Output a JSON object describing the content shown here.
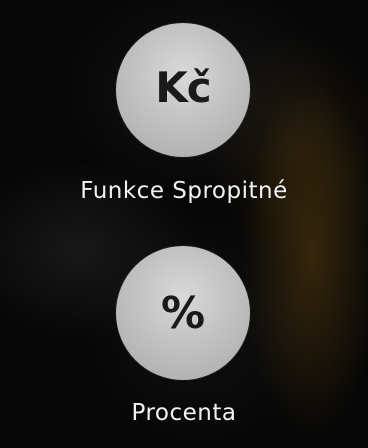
{
  "options": [
    {
      "icon": "koruna-currency-icon",
      "glyph": "Kč",
      "label": "Funkce Spropitné"
    },
    {
      "icon": "percent-icon",
      "glyph": "%",
      "label": "Procenta"
    }
  ],
  "colors": {
    "button_face": "#c2c2c2",
    "glyph": "#1a1a1a",
    "label": "#f2f2f2",
    "background": "#070707"
  }
}
